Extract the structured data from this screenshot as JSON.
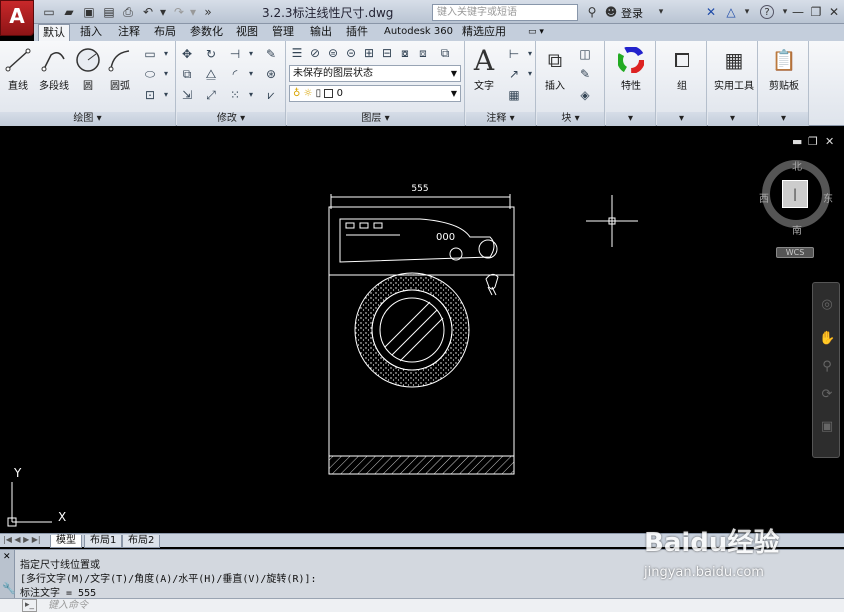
{
  "titlebar": {
    "app_button_label": "A",
    "document_title": "3.2.3标注线性尺寸.dwg",
    "search_placeholder": "键入关键字或短语",
    "login_label": "登录",
    "help_label": "?"
  },
  "tabs": [
    "默认",
    "插入",
    "注释",
    "布局",
    "参数化",
    "视图",
    "管理",
    "输出",
    "插件",
    "Autodesk 360",
    "精选应用"
  ],
  "active_tab": "默认",
  "ribbon": {
    "draw_panel": {
      "label": "绘图 ▾",
      "buttons": [
        "直线",
        "多段线",
        "圆",
        "圆弧"
      ]
    },
    "modify_panel": {
      "label": "修改 ▾"
    },
    "layers_panel": {
      "label": "图层 ▾",
      "layer_state": "未保存的图层状态",
      "current_layer": "0"
    },
    "annotation_panel": {
      "label": "注释 ▾",
      "text_button": "文字"
    },
    "block_panel": {
      "label": "块 ▾",
      "insert_button": "插入"
    },
    "properties_button": "特性",
    "group_button": "组",
    "utilities_button": "实用工具",
    "clipboard_button": "剪贴板"
  },
  "canvas": {
    "dimension_text": "555",
    "viewcube": {
      "north": "北",
      "south": "南",
      "east": "东",
      "west": "西",
      "wcs": "WCS"
    },
    "ucs": {
      "x": "X",
      "y": "Y"
    }
  },
  "layout_tabs": [
    "模型",
    "布局1",
    "布局2"
  ],
  "active_layout": "模型",
  "command": {
    "history": [
      "指定尺寸线位置或",
      "[多行文字(M)/文字(T)/角度(A)/水平(H)/垂直(V)/旋转(R)]:",
      "标注文字 = 555"
    ],
    "input_placeholder": "键入命令"
  },
  "watermark": {
    "brand": "Baidu经验",
    "url": "jingyan.baidu.com"
  },
  "colors": {
    "accent": "#c8282a",
    "canvas": "#000000",
    "drawing_lines": "#ffffff"
  }
}
